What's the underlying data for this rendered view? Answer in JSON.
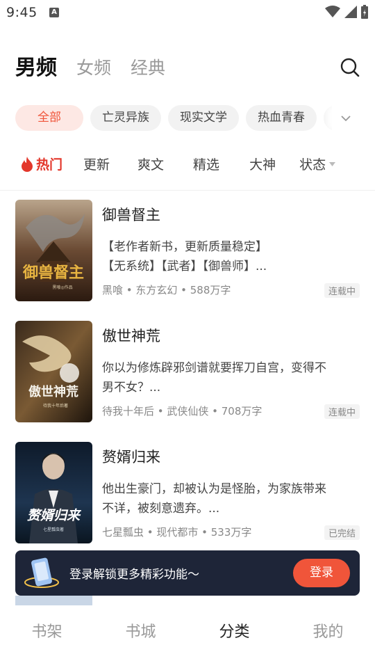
{
  "status_bar": {
    "time": "9:45",
    "notif_icon": "A"
  },
  "top_tabs": [
    {
      "label": "男频",
      "active": true
    },
    {
      "label": "女频",
      "active": false
    },
    {
      "label": "经典",
      "active": false
    }
  ],
  "chips": [
    {
      "label": "全部",
      "active": true
    },
    {
      "label": "亡灵异族"
    },
    {
      "label": "现实文学"
    },
    {
      "label": "热血青春"
    }
  ],
  "filters": {
    "hot_label": "热门",
    "items": [
      "更新",
      "爽文",
      "精选",
      "大神"
    ],
    "status_label": "状态"
  },
  "books": [
    {
      "title": "御兽督主",
      "desc_line1": "【老作者新书，更新质量稳定】",
      "desc_line2": "【无系统】【武者】【御兽师】...",
      "meta": "黑喰 • 东方玄幻 • 588万字",
      "badge": "连载中",
      "cover_title": "御兽督主",
      "cover_sub": "黑喰◎作品"
    },
    {
      "title": "傲世神荒",
      "desc_line1": "你以为修炼辟邪剑谱就要挥刀自宫，变得不",
      "desc_line2": "男不女？...",
      "meta": "待我十年后 • 武侠仙侠 • 708万字",
      "badge": "连载中",
      "cover_title": "傲世神荒",
      "cover_sub": "待我十年后著"
    },
    {
      "title": "赘婿归来",
      "desc_line1": "他出生豪门，却被认为是怪胎，为家族带来",
      "desc_line2": "不详，被刻意遗弃。...",
      "meta": "七星瓢虫 • 现代都市 • 533万字",
      "badge": "已完结",
      "cover_title": "赘婿归来",
      "cover_sub": "七星瓢虫著"
    }
  ],
  "login_banner": {
    "text": "登录解锁更多精彩功能～",
    "button": "登录"
  },
  "bottom_nav": [
    {
      "label": "书架"
    },
    {
      "label": "书城"
    },
    {
      "label": "分类",
      "active": true
    },
    {
      "label": "我的"
    }
  ],
  "colors": {
    "accent": "#f0553a",
    "hot": "#e3372b",
    "banner_bg": "#1e2538"
  }
}
